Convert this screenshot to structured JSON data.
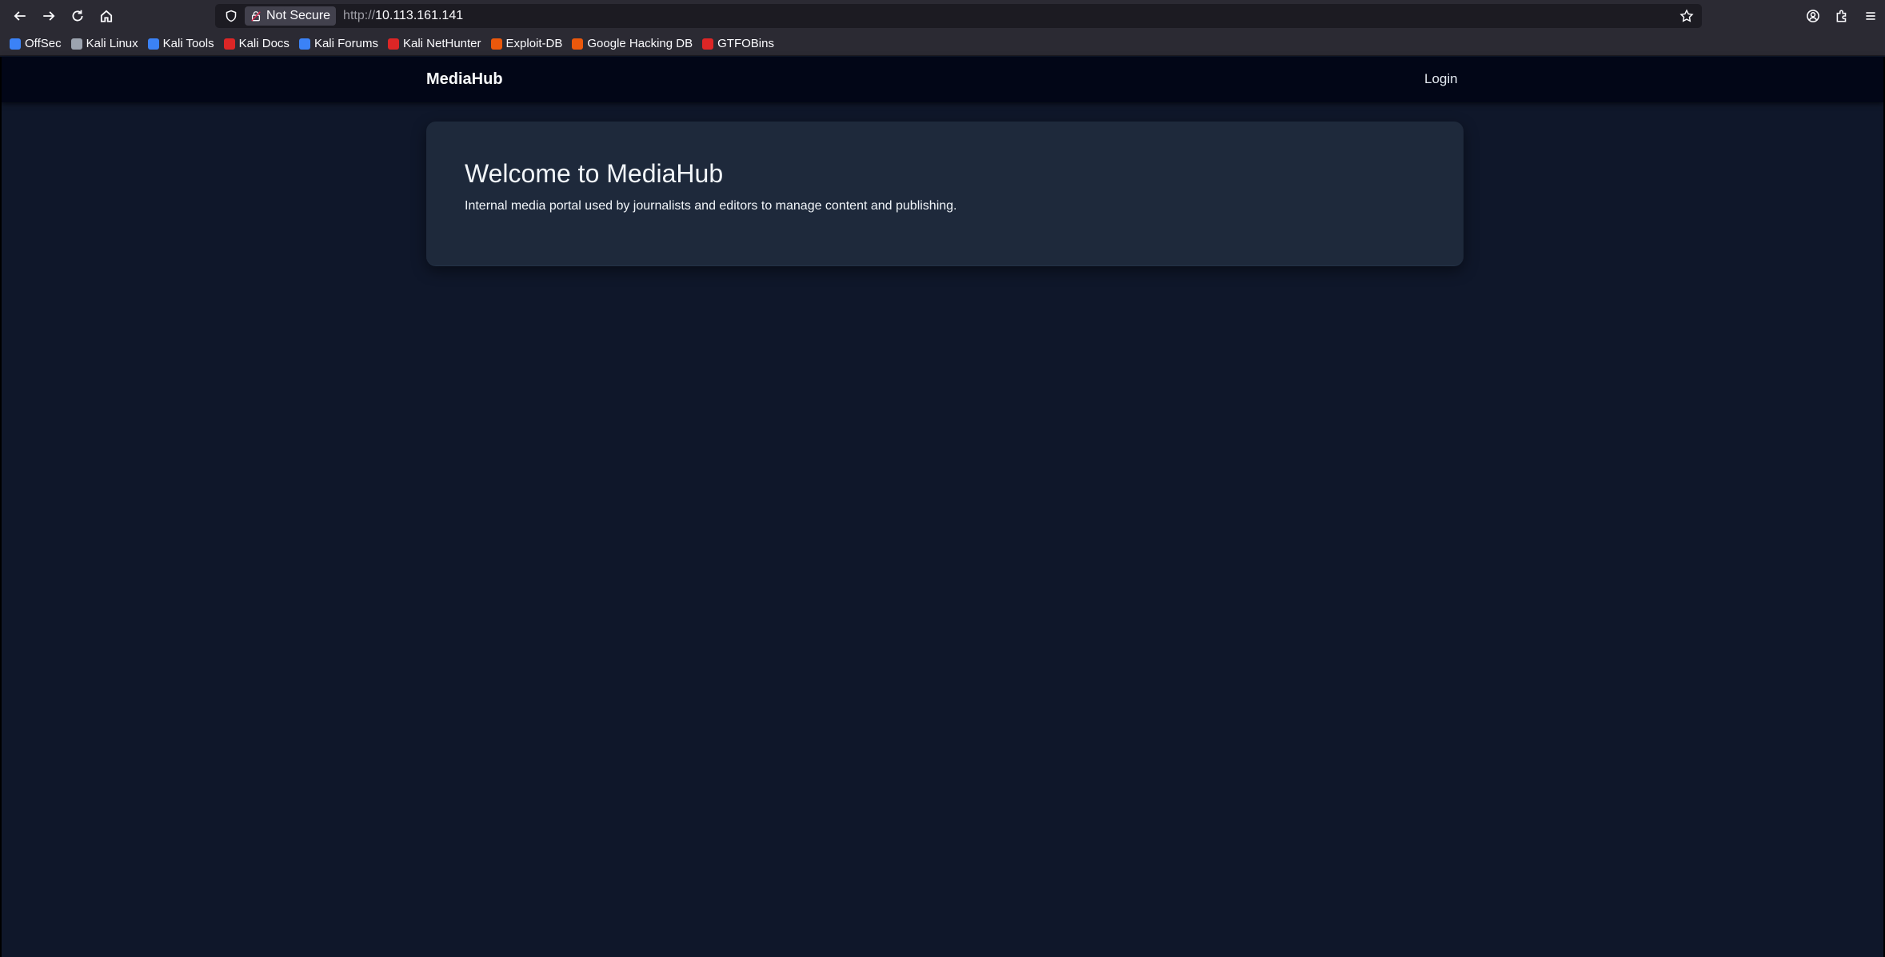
{
  "browser": {
    "security_label": "Not Secure",
    "url_scheme": "http://",
    "url_host": "10.113.161.141",
    "bookmarks": [
      {
        "label": "OffSec",
        "color": "#3b82f6"
      },
      {
        "label": "Kali Linux",
        "color": "#9ca3af"
      },
      {
        "label": "Kali Tools",
        "color": "#3b82f6"
      },
      {
        "label": "Kali Docs",
        "color": "#dc2626"
      },
      {
        "label": "Kali Forums",
        "color": "#3b82f6"
      },
      {
        "label": "Kali NetHunter",
        "color": "#dc2626"
      },
      {
        "label": "Exploit-DB",
        "color": "#ea580c"
      },
      {
        "label": "Google Hacking DB",
        "color": "#ea580c"
      },
      {
        "label": "GTFOBins",
        "color": "#dc2626"
      }
    ]
  },
  "site": {
    "brand": "MediaHub",
    "login_label": "Login",
    "welcome_title": "Welcome to MediaHub",
    "welcome_text": "Internal media portal used by journalists and editors to manage content and publishing."
  },
  "colors": {
    "page_bg": "#0f172a",
    "header_bg": "#020617",
    "card_bg": "#1e293b"
  }
}
